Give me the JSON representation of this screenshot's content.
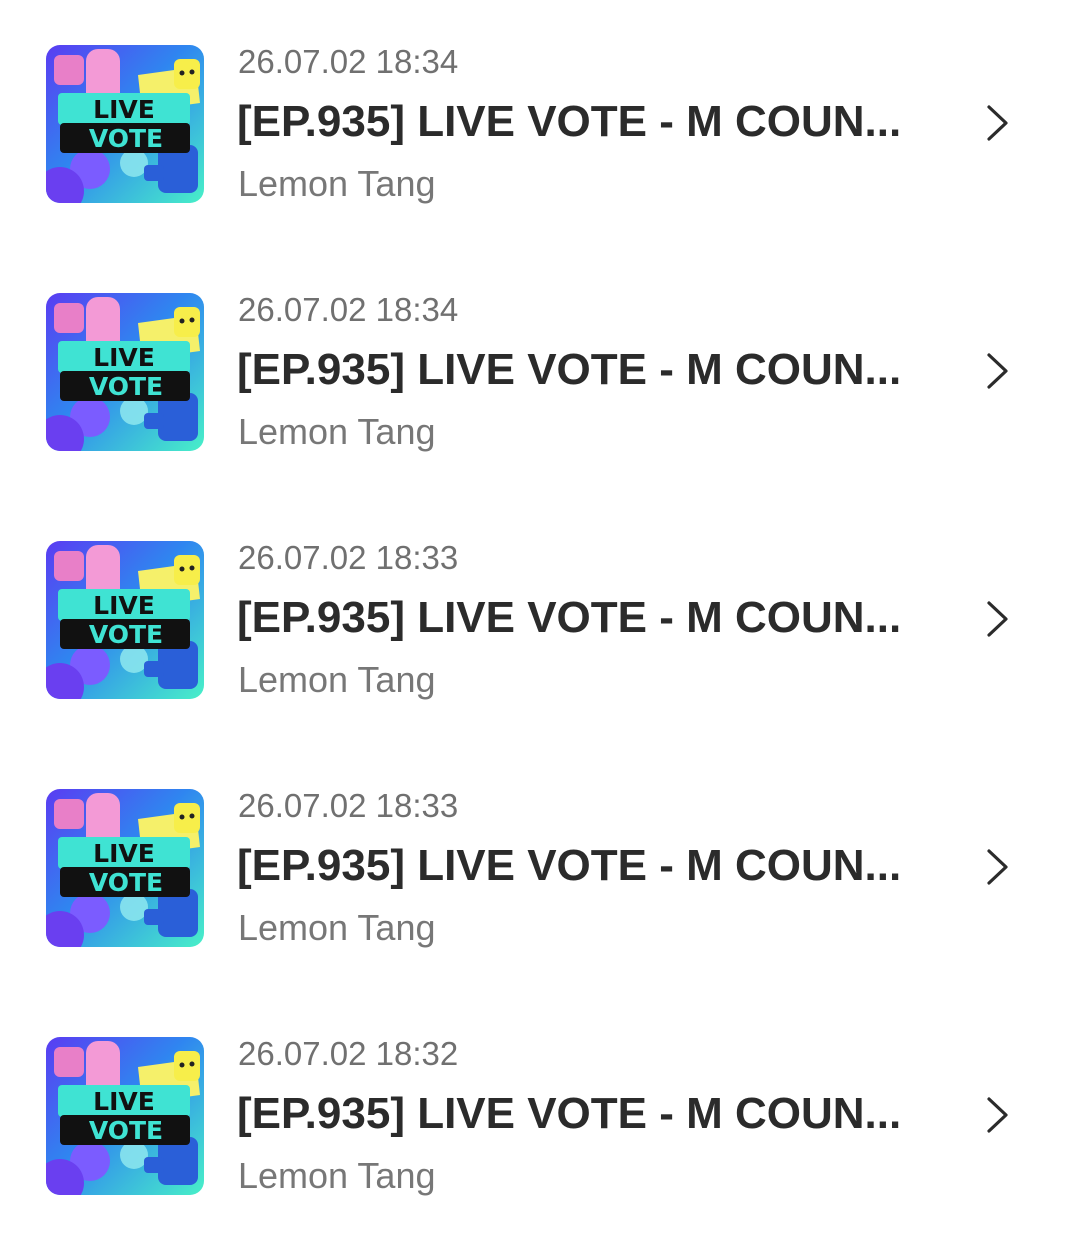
{
  "list": {
    "items": [
      {
        "date": "26.07.02 18:34",
        "title": "[EP.935] LIVE VOTE - M COUN...",
        "author": "Lemon Tang",
        "thumb_text_1": "LIVE",
        "thumb_text_2": "VOTE"
      },
      {
        "date": "26.07.02 18:34",
        "title": "[EP.935] LIVE VOTE - M COUN...",
        "author": "Lemon Tang",
        "thumb_text_1": "LIVE",
        "thumb_text_2": "VOTE"
      },
      {
        "date": "26.07.02 18:33",
        "title": "[EP.935] LIVE VOTE - M COUN...",
        "author": "Lemon Tang",
        "thumb_text_1": "LIVE",
        "thumb_text_2": "VOTE"
      },
      {
        "date": "26.07.02 18:33",
        "title": "[EP.935] LIVE VOTE - M COUN...",
        "author": "Lemon Tang",
        "thumb_text_1": "LIVE",
        "thumb_text_2": "VOTE"
      },
      {
        "date": "26.07.02 18:32",
        "title": "[EP.935] LIVE VOTE - M COUN...",
        "author": "Lemon Tang",
        "thumb_text_1": "LIVE",
        "thumb_text_2": "VOTE"
      }
    ]
  },
  "icons": {
    "row_arrow": "chevron-right-icon",
    "thumbnail": "live-vote-thumbnail"
  },
  "colors": {
    "background": "#ffffff",
    "title_text": "#2b2b2b",
    "date_text": "#707070",
    "author_text": "#777777",
    "thumb_teal": "#3fe3d3",
    "thumb_blue": "#2f86f0",
    "thumb_purple": "#6b3cf0",
    "thumb_pink": "#f39ad6",
    "thumb_yellow": "#f5f06a"
  }
}
